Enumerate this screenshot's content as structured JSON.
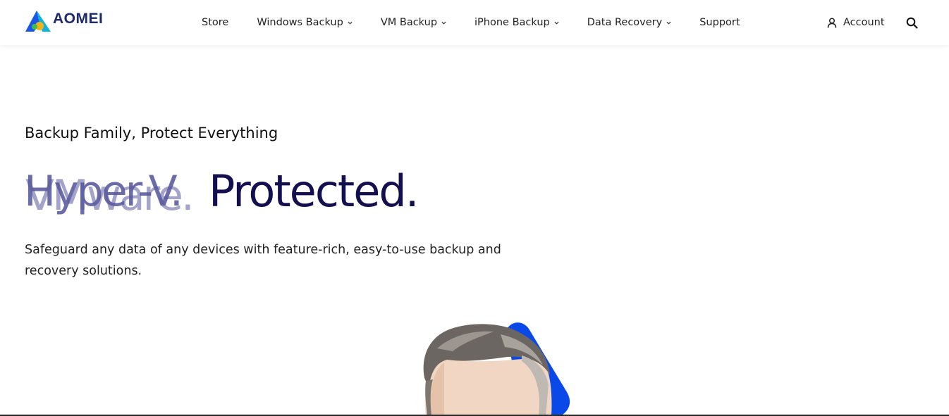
{
  "brand": {
    "name": "AOMEI",
    "accent": "#0a49e8",
    "navy": "#14104f"
  },
  "nav": {
    "items": [
      {
        "label": "Store",
        "has_dropdown": false
      },
      {
        "label": "Windows Backup",
        "has_dropdown": true
      },
      {
        "label": "VM Backup",
        "has_dropdown": true
      },
      {
        "label": "iPhone Backup",
        "has_dropdown": true
      },
      {
        "label": "Data Recovery",
        "has_dropdown": true
      },
      {
        "label": "Support",
        "has_dropdown": false
      }
    ],
    "account_label": "Account",
    "account_icon": "user-icon",
    "search_icon": "search-icon"
  },
  "hero": {
    "eyebrow": "Backup Family, Protect Everything",
    "rotating_word_a": "Hyper-V.",
    "rotating_word_b": "VMware.",
    "headline_tail": "Protected.",
    "subtext": "Safeguard any data of any devices with feature-rich, easy-to-use backup and recovery solutions."
  }
}
